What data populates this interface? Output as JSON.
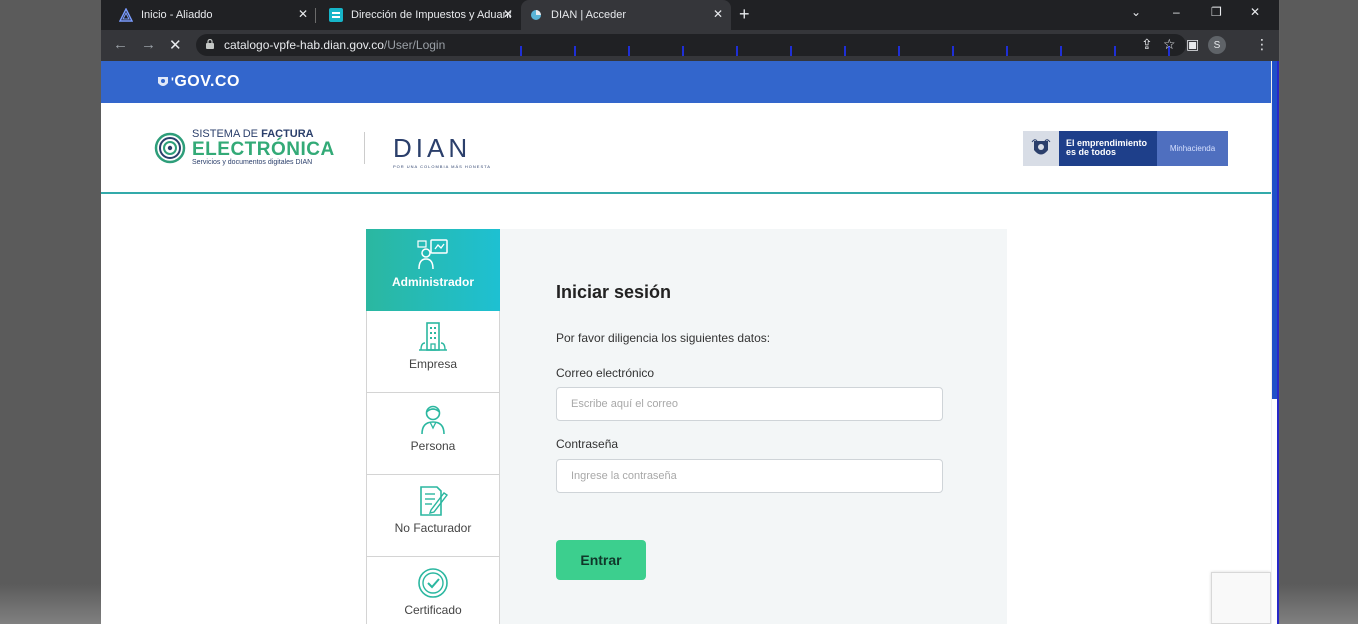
{
  "browser": {
    "tabs": [
      {
        "title": "Inicio - Aliaddo",
        "icon": "aliaddo-icon"
      },
      {
        "title": "Dirección de Impuestos y Aduana",
        "icon": "dian-tab-icon"
      },
      {
        "title": "DIAN | Acceder",
        "icon": "loading-icon",
        "active": true
      }
    ],
    "url_host": "catalogo-vpfe-hab.dian.gov.co",
    "url_path": "/User/Login",
    "profile_initial": "S"
  },
  "gov": {
    "brand": "GOV.CO",
    "color": "#3366cc"
  },
  "header": {
    "sfe_line1_a": "SISTEMA DE ",
    "sfe_line1_b": "FACTURA",
    "sfe_line2": "ELECTRÓNICA",
    "sfe_line3": "Servicios y documentos digitales DIAN",
    "dian": "DIAN",
    "dian_tagline": "POR UNA COLOMBIA MÁS HONESTA",
    "badge_line1": "El emprendimiento",
    "badge_line2": "es de todos",
    "badge_ministry": "Minhacienda"
  },
  "roles": [
    {
      "label": "Administrador",
      "icon": "admin-icon",
      "active": true
    },
    {
      "label": "Empresa",
      "icon": "building-icon"
    },
    {
      "label": "Persona",
      "icon": "person-icon"
    },
    {
      "label": "No Facturador",
      "icon": "document-pen-icon"
    },
    {
      "label": "Certificado",
      "icon": "certificate-icon"
    }
  ],
  "login": {
    "title": "Iniciar sesión",
    "subtitle": "Por favor diligencia los siguientes datos:",
    "email_label": "Correo electrónico",
    "email_placeholder": "Escribe aquí el correo",
    "email_value": "",
    "password_label": "Contraseña",
    "password_placeholder": "Ingrese la contraseña",
    "password_value": "",
    "submit_label": "Entrar",
    "accent_color": "#3ccf8e"
  }
}
